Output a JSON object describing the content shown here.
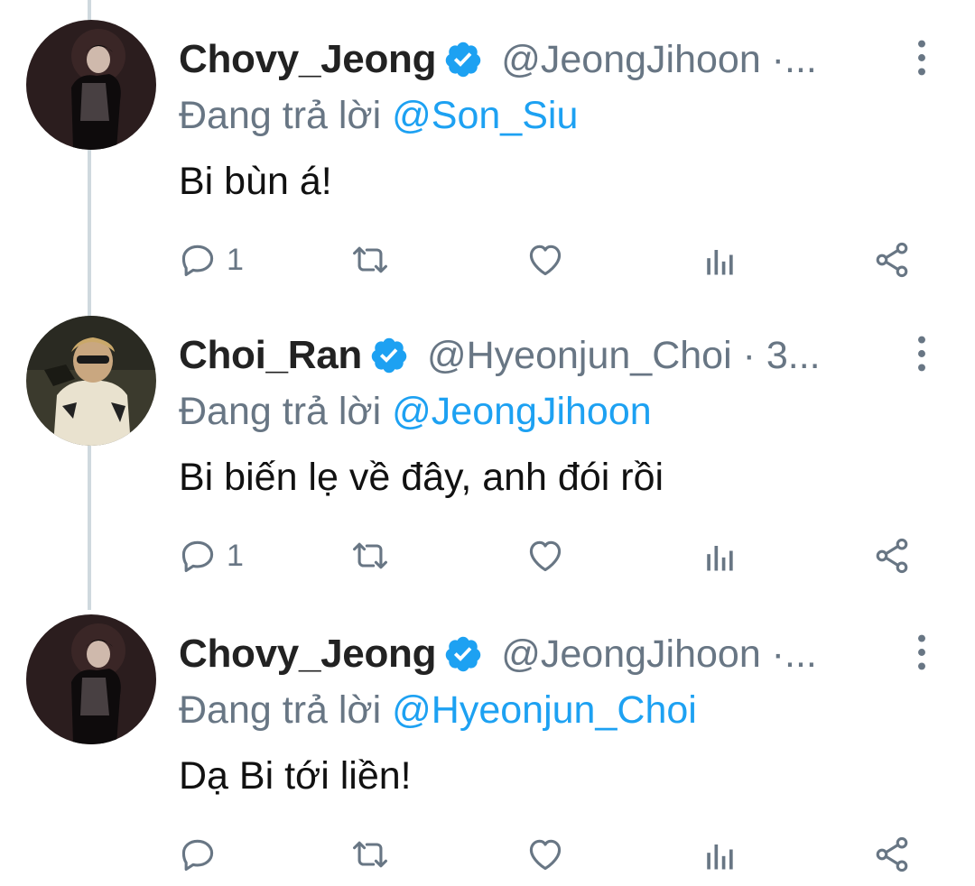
{
  "colors": {
    "accent": "#1da1f2",
    "secondary_text": "#687684",
    "primary_text": "#111111",
    "thread_line": "#cfd9de"
  },
  "tweets": [
    {
      "name": "Chovy_Jeong",
      "handle": "@JeongJihoon ·...",
      "reply_prefix": "Đang trả lời",
      "reply_to": "@Son_Siu",
      "text": "Bi bùn á!",
      "reply_count": "1",
      "avatar_icon": "avatar-photo"
    },
    {
      "name": "Choi_Ran",
      "handle": "@Hyeonjun_Choi · 3...",
      "reply_prefix": "Đang trả lời",
      "reply_to": "@JeongJihoon",
      "text": "Bi biến lẹ về đây, anh đói rồi",
      "reply_count": "1",
      "avatar_icon": "avatar-photo"
    },
    {
      "name": "Chovy_Jeong",
      "handle": "@JeongJihoon ·...",
      "reply_prefix": "Đang trả lời",
      "reply_to": "@Hyeonjun_Choi",
      "text": "Dạ Bi tới liền!",
      "reply_count": "",
      "avatar_icon": "avatar-photo"
    }
  ],
  "action_icons": [
    "reply-icon",
    "retweet-icon",
    "like-icon",
    "analytics-icon",
    "share-icon"
  ]
}
